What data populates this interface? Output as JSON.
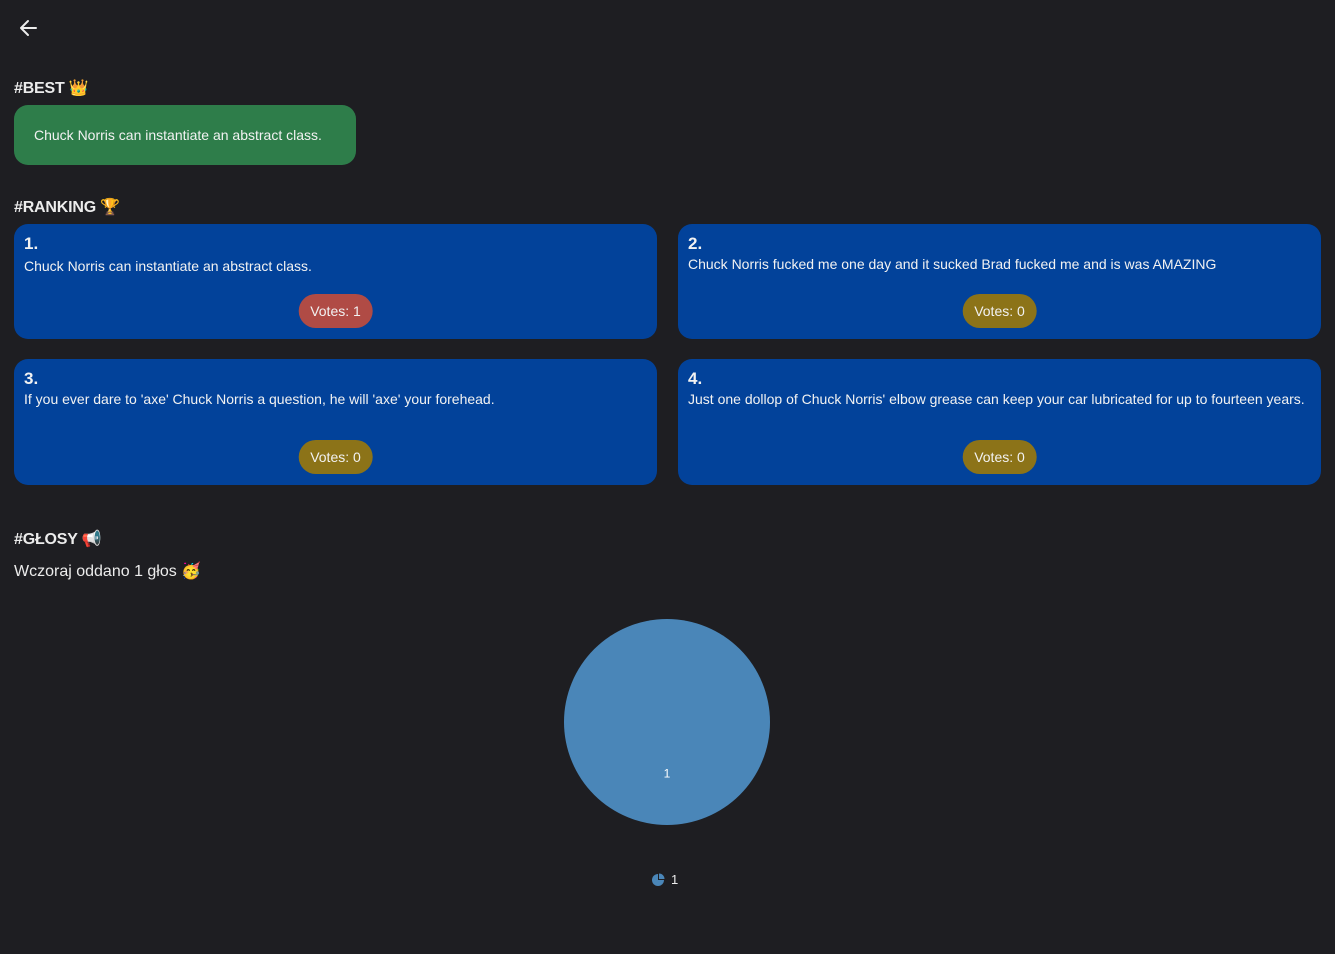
{
  "header": {
    "back_icon": "arrow-left-icon"
  },
  "best": {
    "title": "#BEST 👑",
    "joke": "Chuck Norris can instantiate an abstract class."
  },
  "ranking": {
    "title": "#RANKING 🏆",
    "items": [
      {
        "rank": "1.",
        "text": "Chuck Norris can instantiate an abstract class.",
        "votes_label": "Votes: 1",
        "pill_color": "#b04b45"
      },
      {
        "rank": "2.",
        "text": "Chuck Norris fucked me one day and it sucked Brad fucked me and is was AMAZING",
        "votes_label": "Votes: 0",
        "pill_color": "#8c7318"
      },
      {
        "rank": "3.",
        "text": "If you ever dare to 'axe' Chuck Norris a question, he will 'axe' your forehead.",
        "votes_label": "Votes: 0",
        "pill_color": "#8c7318"
      },
      {
        "rank": "4.",
        "text": "Just one dollop of Chuck Norris' elbow grease can keep your car lubricated for up to fourteen years.",
        "votes_label": "Votes: 0",
        "pill_color": "#8c7318"
      }
    ]
  },
  "votes": {
    "title": "#GŁOSY 📢",
    "summary": "Wczoraj oddano 1 głos 🥳"
  },
  "chart_data": {
    "type": "pie",
    "categories": [
      "1"
    ],
    "values": [
      1
    ],
    "slice_labels": [
      "1"
    ],
    "legend": [
      "1"
    ],
    "legend_position": "bottom",
    "colors": [
      "#4a86b8"
    ]
  },
  "colors": {
    "background": "#1e1e22",
    "best_card": "#2e7d4a",
    "rank_card": "#02429a",
    "text": "#ececec"
  }
}
